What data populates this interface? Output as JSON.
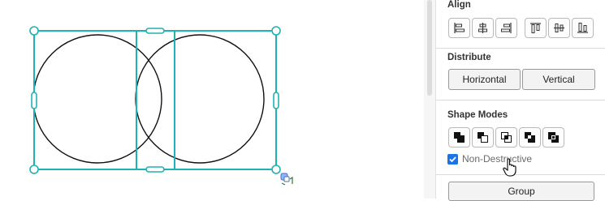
{
  "canvas": {
    "selection_color": "#20b2b2",
    "shape_stroke": "#111111",
    "shapes": [
      "circle",
      "circle"
    ]
  },
  "panel": {
    "align": {
      "title": "Align",
      "buttons": [
        "align-left-icon",
        "align-horizontal-center-icon",
        "align-right-icon",
        "align-top-icon",
        "align-vertical-center-icon",
        "align-bottom-icon"
      ]
    },
    "distribute": {
      "title": "Distribute",
      "horizontal_label": "Horizontal",
      "vertical_label": "Vertical"
    },
    "shape_modes": {
      "title": "Shape Modes",
      "buttons": [
        "unite-icon",
        "minus-front-icon",
        "intersect-icon",
        "exclude-icon",
        "divide-icon"
      ],
      "non_destructive_label": "Non-Destructive",
      "non_destructive_checked": true,
      "accent": "#1a73e8"
    },
    "group_label": "Group"
  }
}
